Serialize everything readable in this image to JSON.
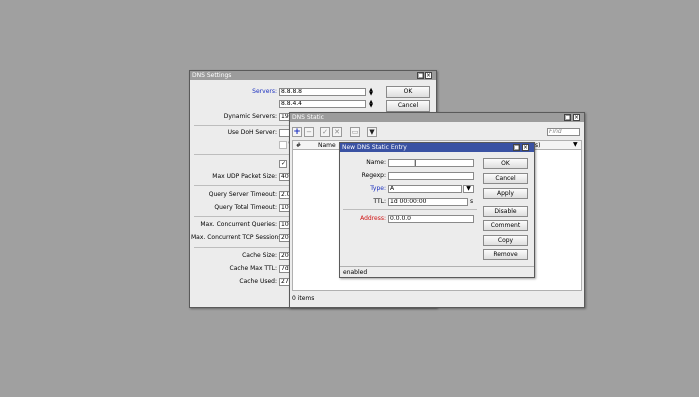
{
  "dns_settings": {
    "title": "DNS Settings",
    "servers_label": "Servers:",
    "server1": "8.8.8.8",
    "server2": "8.8.4.4",
    "ok": "OK",
    "cancel": "Cancel",
    "dynamic_servers_label": "Dynamic Servers:",
    "dynamic_servers_value": "192",
    "use_doh_label": "Use DoH Server:",
    "verify_doh_label": "V",
    "max_udp_label": "Max UDP Packet Size:",
    "max_udp_value": "409",
    "query_server_timeout_label": "Query Server Timeout:",
    "query_server_timeout_value": "2.0",
    "query_total_timeout_label": "Query Total Timeout:",
    "query_total_timeout_value": "10.",
    "max_concurrent_queries_label": "Max. Concurrent Queries:",
    "max_concurrent_queries_value": "100",
    "max_concurrent_tcp_label": "Max. Concurrent TCP Sessions:",
    "max_concurrent_tcp_value": "20",
    "cache_size_label": "Cache Size:",
    "cache_size_value": "204",
    "cache_max_ttl_label": "Cache Max TTL:",
    "cache_max_ttl_value": "7d",
    "cache_used_label": "Cache Used:",
    "cache_used_value": "27"
  },
  "dns_static": {
    "title": "DNS Static",
    "find_placeholder": "Find",
    "col_hash": "#",
    "col_name": "Name",
    "col_partial": "s)",
    "status": "0 items"
  },
  "new_entry": {
    "title": "New DNS Static Entry",
    "name_label": "Name:",
    "name_value": "",
    "regexp_label": "Regexp:",
    "regexp_value": "",
    "type_label": "Type:",
    "type_value": "A",
    "ttl_label": "TTL:",
    "ttl_value": "1d 00:00:00",
    "ttl_unit": "s",
    "address_label": "Address:",
    "address_value": "0.0.0.0",
    "buttons": {
      "ok": "OK",
      "cancel": "Cancel",
      "apply": "Apply",
      "disable": "Disable",
      "comment": "Comment",
      "copy": "Copy",
      "remove": "Remove"
    },
    "status": "enabled"
  }
}
